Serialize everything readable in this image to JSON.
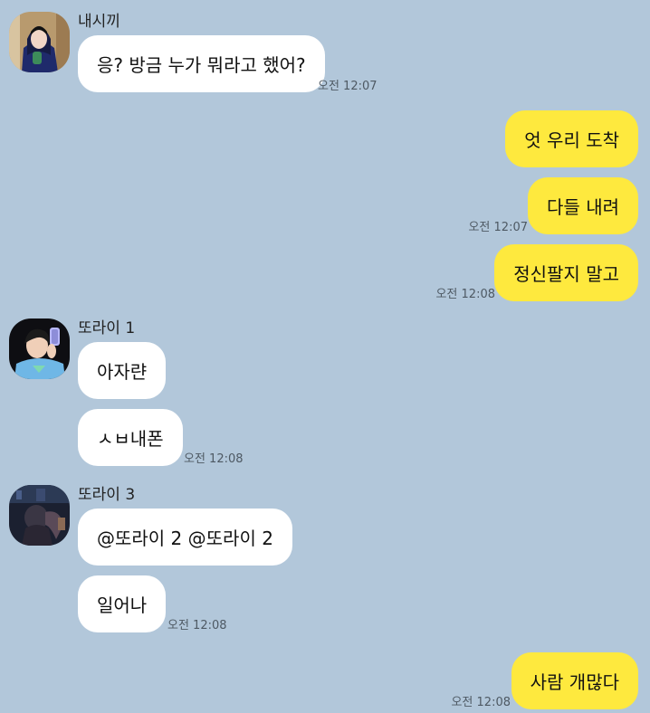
{
  "chat": {
    "groups": [
      {
        "sender": "내시끼",
        "avatar": "profile-photo-hooded-girl",
        "messages": [
          {
            "text": "응? 방금 누가 뭐라고 했어?",
            "time": "오전 12:07"
          }
        ]
      },
      {
        "sender": "me",
        "messages": [
          {
            "text": "엇 우리 도착",
            "time": ""
          },
          {
            "text": "다들 내려",
            "time": "오전 12:07"
          },
          {
            "text": "정신팔지 말고",
            "time": "오전 12:08"
          }
        ]
      },
      {
        "sender": "또라이 1",
        "avatar": "profile-photo-mirror-selfie",
        "messages": [
          {
            "text": "아자랸",
            "time": ""
          },
          {
            "text": "ㅅㅂ내폰",
            "time": "오전 12:08"
          }
        ]
      },
      {
        "sender": "또라이 3",
        "avatar": "profile-photo-dark-night",
        "messages": [
          {
            "text": "@또라이 2 @또라이 2",
            "time": ""
          },
          {
            "text": "일어나",
            "time": "오전 12:08"
          }
        ]
      },
      {
        "sender": "me",
        "messages": [
          {
            "text": "사람 개많다",
            "time": "오전 12:08"
          }
        ]
      }
    ]
  },
  "colors": {
    "background": "#b2c7da",
    "incoming_bubble": "#ffffff",
    "outgoing_bubble": "#fee93e"
  }
}
